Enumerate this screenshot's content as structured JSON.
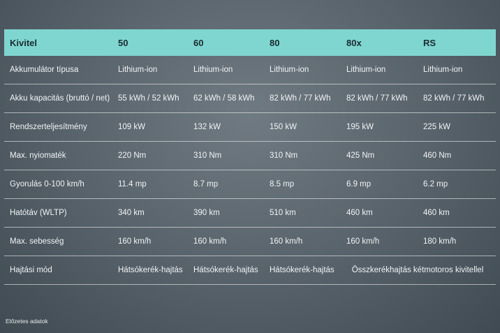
{
  "table": {
    "headers": [
      "Kivitel",
      "50",
      "60",
      "80",
      "80x",
      "RS"
    ],
    "rows": [
      [
        "Akkumulátor típusa",
        "Lithium-ion",
        "Lithium-ion",
        "Lithium-ion",
        "Lithium-ion",
        "Lithium-ion"
      ],
      [
        "Akku kapacitás (bruttó / net)",
        "55 kWh / 52 kWh",
        "62 kWh / 58 kWh",
        "82 kWh / 77 kWh",
        "82 kWh / 77 kWh",
        "82 kWh / 77 kWh"
      ],
      [
        "Rendszerteljesítmény",
        "109 kW",
        "132 kW",
        "150 kW",
        "195 kW",
        "225 kW"
      ],
      [
        "Max. nyiomaték",
        "220 Nm",
        "310 Nm",
        "310 Nm",
        "425 Nm",
        "460 Nm"
      ],
      [
        "Gyorulás 0-100 km/h",
        "11.4 mp",
        "8.7 mp",
        "8.5 mp",
        "6.9 mp",
        "6.2 mp"
      ],
      [
        "Hatótáv (WLTP)",
        "340 km",
        "390 km",
        "510 km",
        "460 km",
        "460 km"
      ],
      [
        "Max. sebesség",
        "160 km/h",
        "160 km/h",
        "160 km/h",
        "160 km/h",
        "180 km/h"
      ]
    ],
    "last_row": {
      "label": "Hajtási mód",
      "c1": "Hátsókerék-hajtás",
      "c2": "Hátsókerék-hajtás",
      "c3": "Hátsókerék-hajtás",
      "c45": "Összkerékhajtás kétmotoros kivitellel"
    }
  },
  "footnote": "Előzetes adatok"
}
